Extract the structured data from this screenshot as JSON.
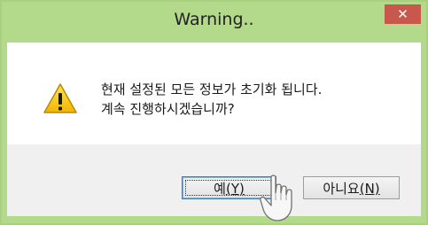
{
  "window": {
    "title": "Warning..",
    "close_glyph": "✕"
  },
  "icon": "warning-icon",
  "message": {
    "line1": "현재 설정된 모든 정보가 초기화 됩니다.",
    "line2": "계속 진행하시겠습니까?"
  },
  "buttons": {
    "yes_label": "예",
    "yes_accel": "(Y)",
    "no_label": "아니요",
    "no_accel": "(N)"
  },
  "colors": {
    "titlebar": "#b3d98a",
    "close_button": "#c9584c",
    "warning_fill": "#f2c200"
  }
}
